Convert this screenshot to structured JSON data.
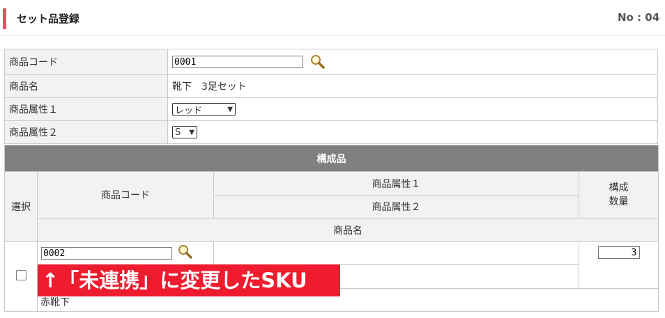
{
  "colors": {
    "accent": "#e8505b",
    "table_header": "#808080",
    "overlay_red": "#ee1c2e"
  },
  "header": {
    "title": "セット品登録",
    "no_label": "No : 04"
  },
  "form": {
    "product_code_label": "商品コード",
    "product_code_value": "0001",
    "product_name_label": "商品名",
    "product_name_value": "靴下　3足セット",
    "attr1_label": "商品属性１",
    "attr1_value": "レッド",
    "attr2_label": "商品属性２",
    "attr2_value": "S"
  },
  "components": {
    "title": "構成品",
    "col_select": "選択",
    "col_code": "商品コード",
    "col_attr1": "商品属性１",
    "col_attr2": "商品属性２",
    "col_qty": "構成\n数量",
    "col_name": "商品名",
    "rows": [
      {
        "code": "0002",
        "qty": "3",
        "name": "赤靴下"
      }
    ]
  },
  "overlay": {
    "text": "↑「未連携」に変更したSKU"
  },
  "icons": {
    "search": "search-icon",
    "dropdown": "chevron-down-icon"
  }
}
